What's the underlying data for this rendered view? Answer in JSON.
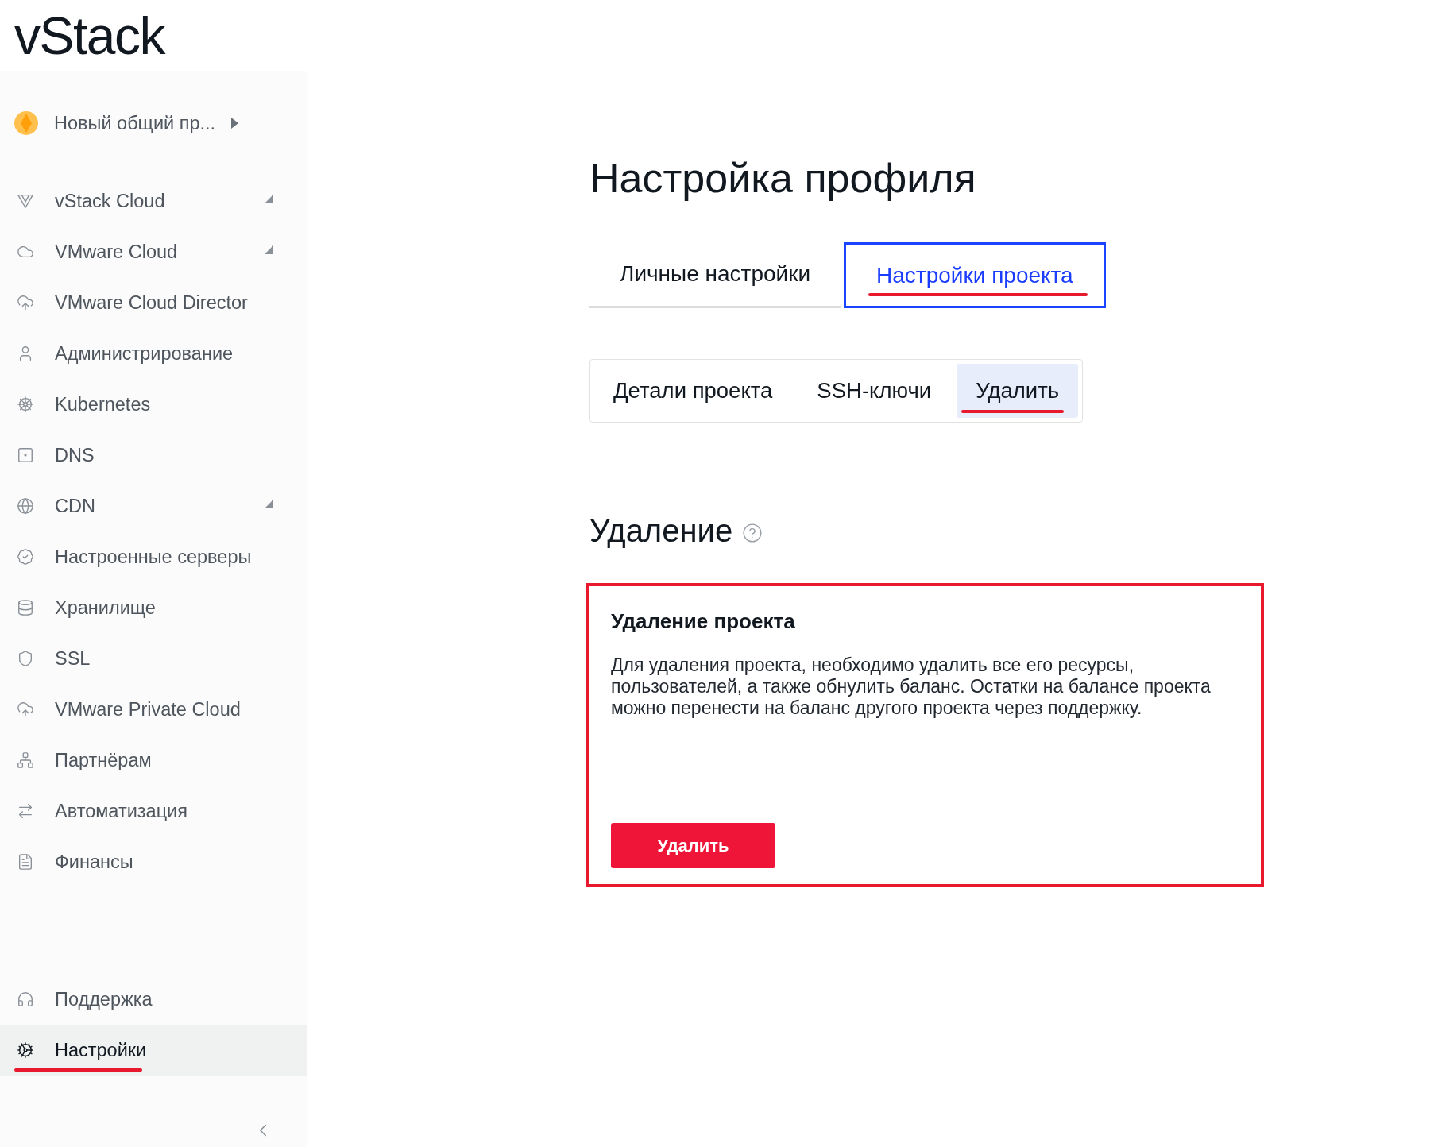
{
  "header": {
    "logo": "vStack"
  },
  "sidebar": {
    "project": {
      "label": "Новый общий пр..."
    },
    "items": [
      {
        "label": "vStack Cloud",
        "submenu": true,
        "selected": false
      },
      {
        "label": "VMware Cloud",
        "submenu": true,
        "selected": false
      },
      {
        "label": "VMware Cloud Director",
        "submenu": false,
        "selected": false
      },
      {
        "label": "Администрирование",
        "submenu": false,
        "selected": false
      },
      {
        "label": "Kubernetes",
        "submenu": false,
        "selected": false
      },
      {
        "label": "DNS",
        "submenu": false,
        "selected": false
      },
      {
        "label": "CDN",
        "submenu": true,
        "selected": false
      },
      {
        "label": "Настроенные серверы",
        "submenu": false,
        "selected": false
      },
      {
        "label": "Хранилище",
        "submenu": false,
        "selected": false
      },
      {
        "label": "SSL",
        "submenu": false,
        "selected": false
      },
      {
        "label": "VMware Private Cloud",
        "submenu": false,
        "selected": false
      },
      {
        "label": "Партнёрам",
        "submenu": false,
        "selected": false
      },
      {
        "label": "Автоматизация",
        "submenu": false,
        "selected": false
      },
      {
        "label": "Финансы",
        "submenu": false,
        "selected": false
      }
    ],
    "bottom_items": [
      {
        "label": "Поддержка",
        "selected": false
      },
      {
        "label": "Настройки",
        "selected": true
      }
    ]
  },
  "page": {
    "title": "Настройка профиля",
    "tabs": [
      {
        "label": "Личные настройки",
        "selected": false
      },
      {
        "label": "Настройки проекта",
        "selected": true
      }
    ],
    "subtabs": [
      {
        "label": "Детали проекта",
        "selected": false
      },
      {
        "label": "SSH-ключи",
        "selected": false
      },
      {
        "label": "Удалить",
        "selected": true
      }
    ],
    "section_title": "Удаление",
    "card": {
      "title": "Удаление проекта",
      "text": "Для удаления проекта, необходимо удалить все его ресурсы, пользователей, а также обнулить баланс. Остатки на балансе проекта можно перенести на баланс другого проекта через поддержку.",
      "button": "Удалить"
    }
  }
}
